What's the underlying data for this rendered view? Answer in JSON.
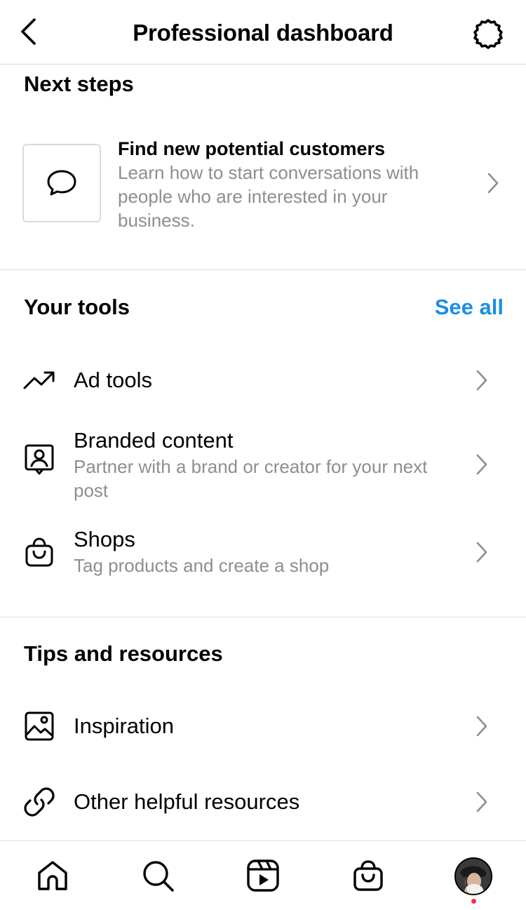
{
  "header": {
    "title": "Professional dashboard",
    "back_icon": "chevron-left-icon",
    "settings_icon": "gear-icon"
  },
  "next_steps": {
    "title": "Next steps",
    "card": {
      "icon": "chat-bubble-icon",
      "title": "Find new potential customers",
      "description": "Learn how to start conversations with people who are interested in your business."
    }
  },
  "your_tools": {
    "title": "Your tools",
    "see_all": "See all",
    "items": [
      {
        "icon": "trending-up-icon",
        "label": "Ad tools",
        "sub": ""
      },
      {
        "icon": "branded-content-icon",
        "label": "Branded content",
        "sub": "Partner with a brand or creator for your next post"
      },
      {
        "icon": "shopping-bag-icon",
        "label": "Shops",
        "sub": "Tag products and create a shop"
      }
    ]
  },
  "tips": {
    "title": "Tips and resources",
    "items": [
      {
        "icon": "image-icon",
        "label": "Inspiration"
      },
      {
        "icon": "link-icon",
        "label": "Other helpful resources"
      }
    ]
  },
  "tabbar": {
    "items": [
      "home-icon",
      "search-icon",
      "reels-icon",
      "shop-icon",
      "profile-avatar"
    ]
  },
  "colors": {
    "accent": "#1a8fe3",
    "secondary_text": "#8e8e8e",
    "divider": "#dbdbdb",
    "notification_dot": "#ff3040"
  }
}
